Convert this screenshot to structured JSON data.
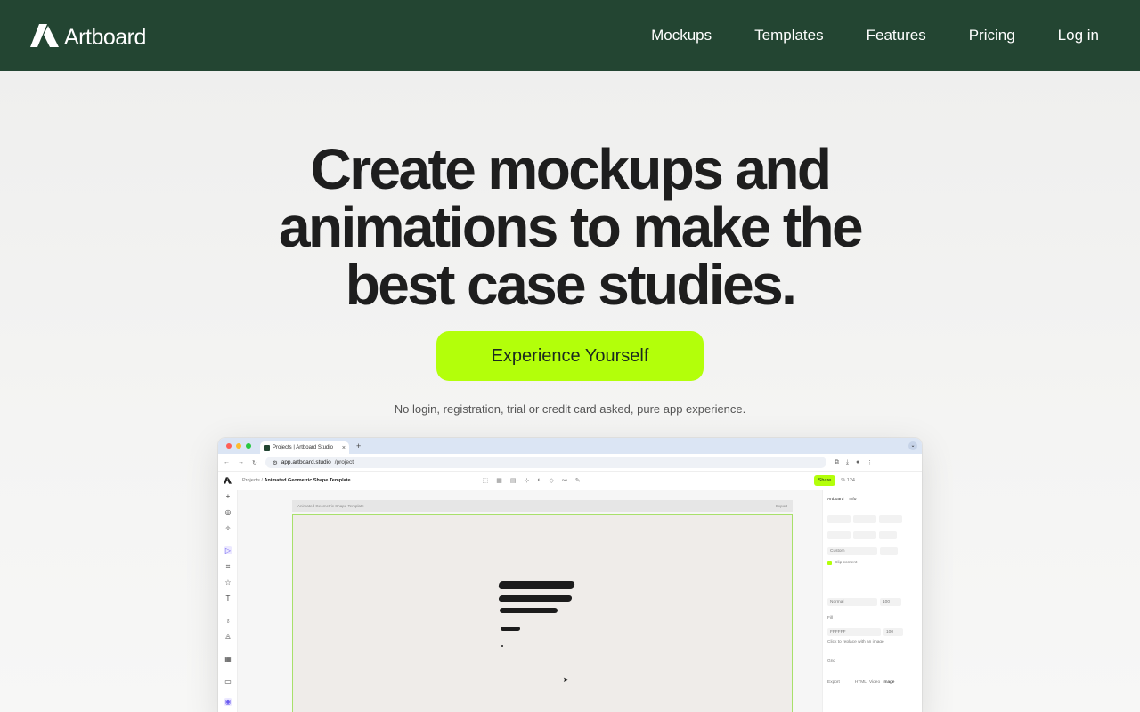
{
  "brand": {
    "name": "Artboard",
    "logo_icon": "artboard-a-logo"
  },
  "nav": {
    "links": [
      "Mockups",
      "Templates",
      "Features",
      "Pricing",
      "Log in"
    ]
  },
  "hero": {
    "title_lines": [
      "Create mockups and",
      "animations to make the",
      "best case studies."
    ],
    "cta_label": "Experience Yourself",
    "subnote": "No login, registration, trial or credit card asked, pure app experience."
  },
  "preview": {
    "tab_title": "Projects | Artboard Studio",
    "tab_close": "×",
    "tab_new": "+",
    "url_prefix": "app.artboard.studio",
    "url_path": "/project",
    "breadcrumb_root": "Projects /",
    "breadcrumb_project": "Animated Geometric Shape Template",
    "share_label": "Share",
    "zoom": "% 124",
    "artboard_label": "Animated Geometric Shape Template",
    "export_label": "Export",
    "panel": {
      "tab_artboard": "Artboard",
      "tab_info": "Info",
      "size_preset": "Custom",
      "clip_label": "Clip content",
      "blend": "Normal",
      "opacity": "100",
      "fill_label": "Fill",
      "fill_hex": "FFFFFF",
      "fill_opacity": "100",
      "fill_hint": "Click to replace with an image",
      "grid_label": "Grid",
      "export_label": "Export",
      "export_options": [
        "HTML",
        "Video",
        "Image"
      ]
    }
  },
  "colors": {
    "nav_bg": "#234532",
    "accent": "#b3ff0a",
    "text": "#1e1e1e"
  }
}
